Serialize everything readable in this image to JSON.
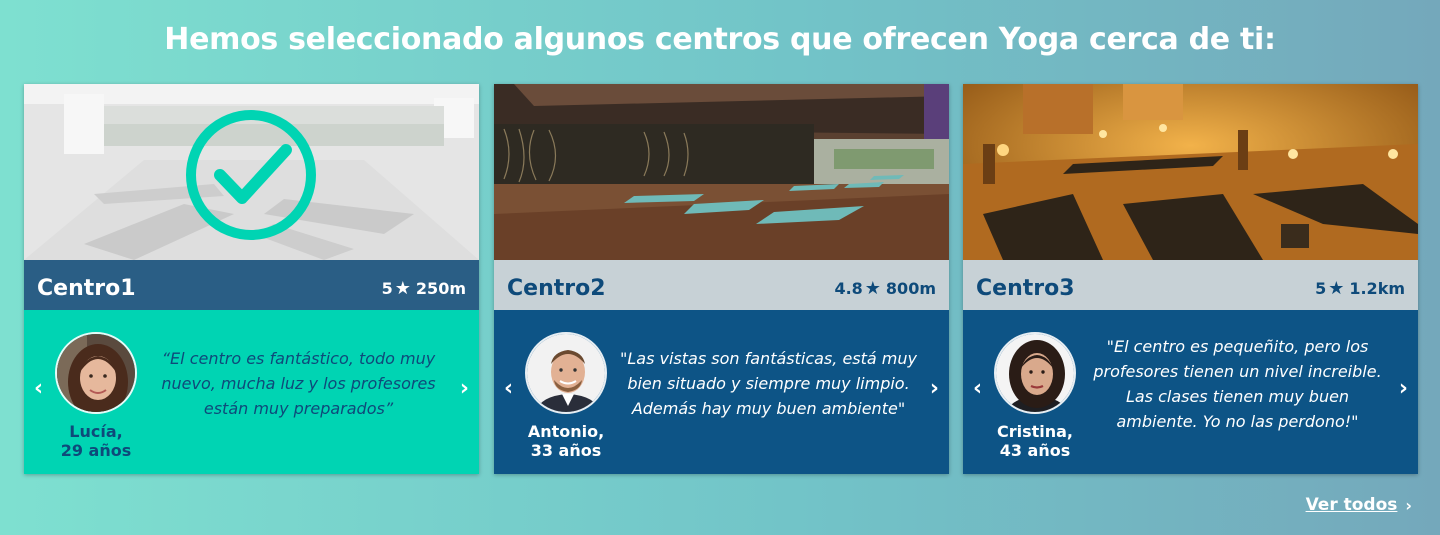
{
  "header": {
    "title": "Hemos seleccionado algunos centros que ofrecen Yoga cerca de ti:"
  },
  "colors": {
    "selected_teal": "#00d4b3",
    "bar_dark": "#2a5e85",
    "bar_light": "#c7d1d6",
    "navy": "#0d5486",
    "text_navy": "#0e4a7a"
  },
  "cards": [
    {
      "name": "Centro1",
      "rating": "5",
      "star_icon": "star-icon",
      "distance": "250m",
      "selected": true,
      "reviewer_name": "Lucía,",
      "reviewer_age": "29 años",
      "quote_lines": [
        "“El centro es fantástico, todo muy",
        "nuevo, mucha luz y los profesores",
        "están muy preparados”"
      ]
    },
    {
      "name": "Centro2",
      "rating": "4.8",
      "star_icon": "star-icon",
      "distance": "800m",
      "selected": false,
      "reviewer_name": "Antonio,",
      "reviewer_age": "33 años",
      "quote_lines": [
        "\"Las vistas son fantásticas, está muy",
        "bien situado y siempre muy limpio.",
        "Además hay muy buen ambiente\""
      ]
    },
    {
      "name": "Centro3",
      "rating": "5",
      "star_icon": "star-icon",
      "distance": "1.2km",
      "selected": false,
      "reviewer_name": "Cristina,",
      "reviewer_age": "43 años",
      "quote_lines": [
        "\"El centro es pequeñito, pero los",
        "profesores tienen un nivel increible.",
        "Las clases tienen muy buen",
        "ambiente. Yo no las perdono!\""
      ]
    }
  ],
  "arrows": {
    "prev": "‹",
    "next": "›"
  },
  "footer": {
    "see_all": "Ver todos",
    "chevron": "›"
  }
}
